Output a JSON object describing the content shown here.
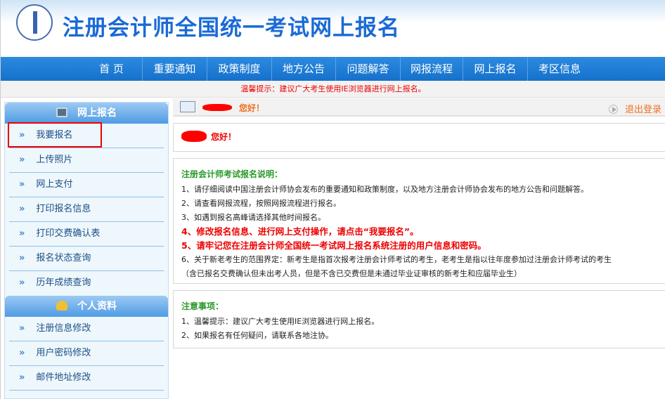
{
  "header": {
    "title": "注册会计师全国统一考试网上报名"
  },
  "nav": [
    "首 页",
    "重要通知",
    "政策制度",
    "地方公告",
    "问题解答",
    "网报流程",
    "网上报名",
    "考区信息"
  ],
  "notice": "温馨提示：建议广大考生使用IE浏览器进行网上报名。",
  "sidebar": {
    "section1": "网上报名",
    "items1": [
      "我要报名",
      "上传照片",
      "网上支付",
      "打印报名信息",
      "打印交费确认表",
      "报名状态查询",
      "历年成绩查询"
    ],
    "section2": "个人资料",
    "items2": [
      "注册信息修改",
      "用户密码修改",
      "邮件地址修改"
    ]
  },
  "greeting": "您好！",
  "logout": "退出登录",
  "welcome": "您好！",
  "instructions": {
    "title": "注册会计师考试报名说明：",
    "lines": [
      "1、请仔细阅读中国注册会计师协会发布的重要通知和政策制度，以及地方注册会计师协会发布的地方公告和问题解答。",
      "2、请查看网报流程，按照网报流程进行报名。",
      "3、如遇到报名高峰请选择其他时间报名。",
      "4、修改报名信息、进行网上支付操作，请点击“我要报名”。",
      "5、请牢记您在注册会计师全国统一考试网上报名系统注册的用户信息和密码。",
      "6、关于新老考生的范围界定：新考生是指首次报考注册会计师考试的考生，老考生是指以往年度参加过注册会计师考试的考生",
      "（含已报名交费确认但未出考人员，但是不含已交费但是未通过毕业证审核的新考生和应届毕业生）"
    ]
  },
  "notes": {
    "title": "注意事项：",
    "lines": [
      "1、温馨提示：建议广大考生使用IE浏览器进行网上报名。",
      "2、如果报名有任何疑问，请联系各地注协。"
    ]
  }
}
